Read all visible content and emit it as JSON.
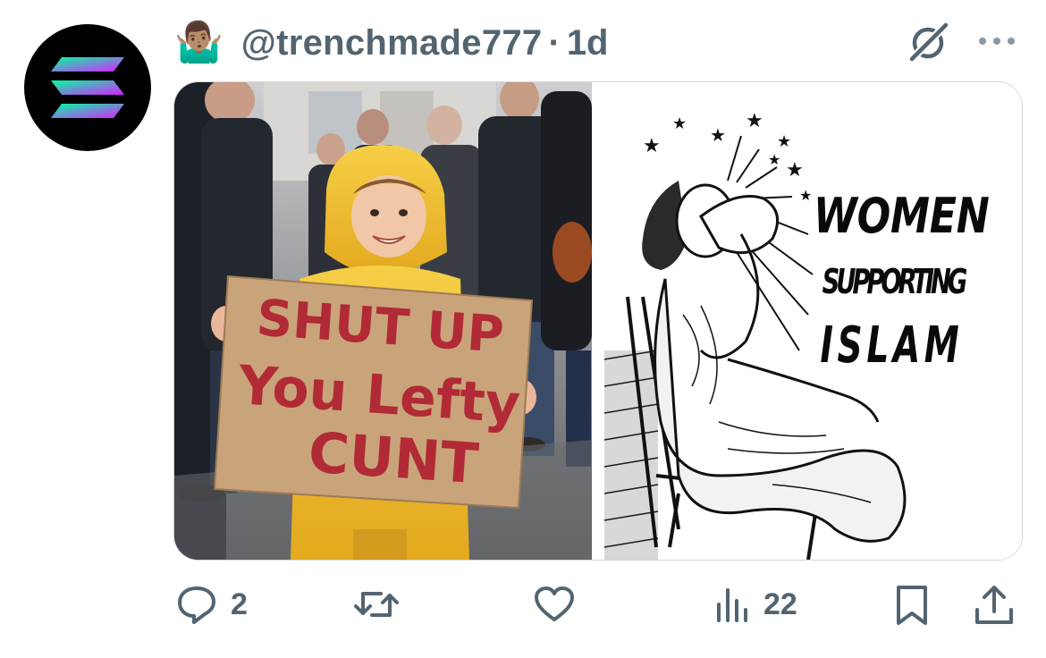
{
  "tweet": {
    "emoji": "🤷🏽‍♂️",
    "handle": "@trenchmade777",
    "separator": "·",
    "time": "1d",
    "avatar_icon": "solana-logo-icon",
    "header_icons": [
      "grok-icon",
      "more-icon"
    ]
  },
  "media": {
    "left_image": {
      "description_icon": "child-with-sign-photo",
      "sign_lines": [
        "SHUT UP",
        "You Lefty",
        "CUNT"
      ]
    },
    "right_image": {
      "description_icon": "cartoon-woman-punching-self",
      "caption_lines": [
        "WOMEN",
        "SUPPORTING",
        "ISLAM"
      ]
    }
  },
  "actions": {
    "replies": "2",
    "retweets": "",
    "likes": "",
    "views": "22",
    "icons": [
      "reply-icon",
      "retweet-icon",
      "like-icon",
      "views-icon",
      "bookmark-icon",
      "share-icon"
    ]
  },
  "colors": {
    "muted": "#536471",
    "sign_red": "#b12a36",
    "raincoat_yellow": "#f0c23a",
    "cardboard": "#c9a47a"
  }
}
